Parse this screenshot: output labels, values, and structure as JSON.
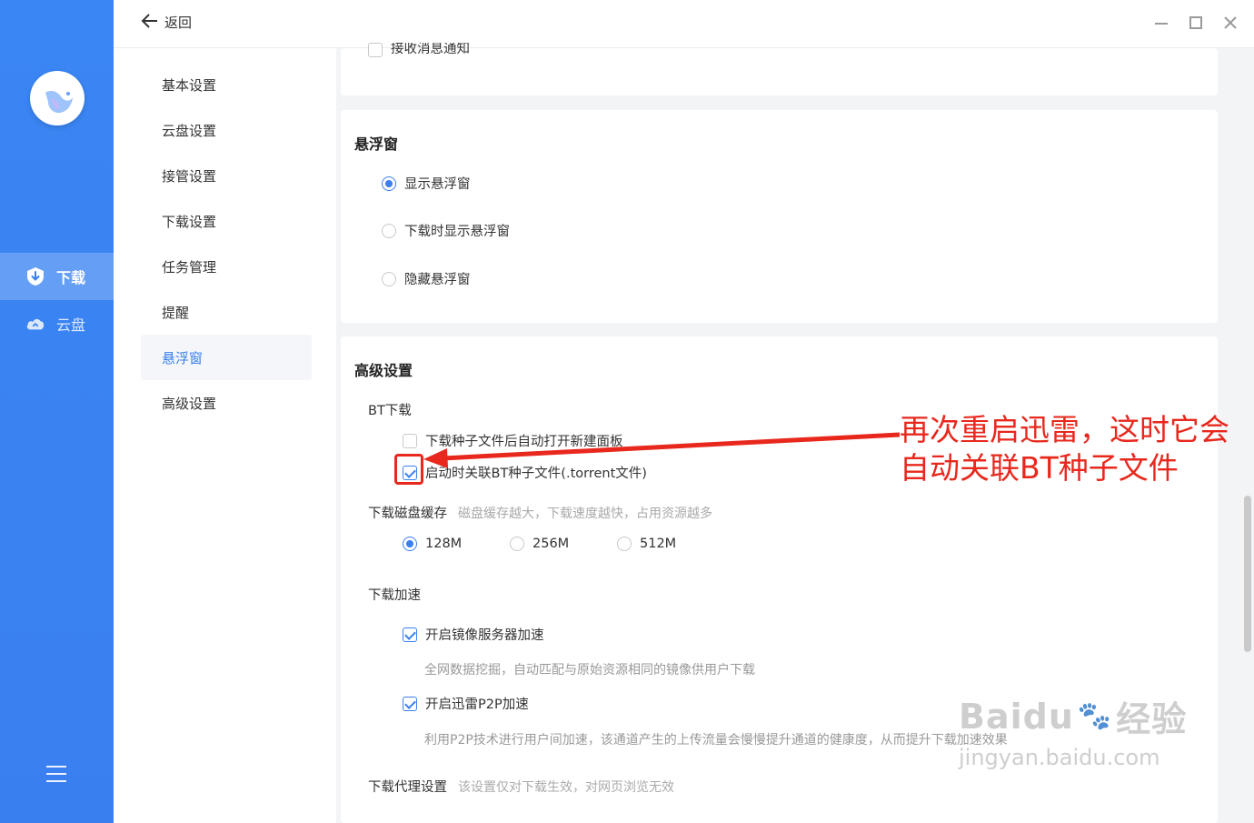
{
  "topbar": {
    "back_label": "返回"
  },
  "rail": {
    "items": [
      {
        "label": "下载",
        "icon": "download-shield-icon",
        "active": true
      },
      {
        "label": "云盘",
        "icon": "cloud-icon",
        "active": false
      }
    ]
  },
  "sidenav": {
    "items": [
      {
        "label": "基本设置"
      },
      {
        "label": "云盘设置"
      },
      {
        "label": "接管设置"
      },
      {
        "label": "下载设置"
      },
      {
        "label": "任务管理"
      },
      {
        "label": "提醒"
      },
      {
        "label": "悬浮窗",
        "active": true
      },
      {
        "label": "高级设置"
      }
    ]
  },
  "reminder_card": {
    "partial_option": "接收消息通知"
  },
  "float_window": {
    "title": "悬浮窗",
    "options": [
      {
        "label": "显示悬浮窗",
        "selected": true
      },
      {
        "label": "下载时显示悬浮窗",
        "selected": false
      },
      {
        "label": "隐藏悬浮窗",
        "selected": false
      }
    ]
  },
  "advanced": {
    "title": "高级设置",
    "bt": {
      "label": "BT下载",
      "opt1": {
        "label": "下载种子文件后自动打开新建面板",
        "checked": false
      },
      "opt2": {
        "label": "启动时关联BT种子文件(.torrent文件)",
        "checked": true
      }
    },
    "cache": {
      "label": "下载磁盘缓存",
      "hint": "磁盘缓存越大，下载速度越快，占用资源越多",
      "options": [
        {
          "label": "128M",
          "selected": true
        },
        {
          "label": "256M",
          "selected": false
        },
        {
          "label": "512M",
          "selected": false
        }
      ]
    },
    "accel": {
      "label": "下载加速",
      "mirror": {
        "label": "开启镜像服务器加速",
        "checked": true,
        "desc": "全网数据挖掘，自动匹配与原始资源相同的镜像供用户下载"
      },
      "p2p": {
        "label": "开启迅雷P2P加速",
        "checked": true,
        "desc": "利用P2P技术进行用户间加速，该通道产生的上传流量会慢慢提升通道的健康度，从而提升下载加速效果"
      }
    },
    "proxy": {
      "label": "下载代理设置",
      "hint": "该设置仅对下载生效，对网页浏览无效"
    }
  },
  "annotation": {
    "line1": "再次重启迅雷，这时它会",
    "line2": "自动关联BT种子文件"
  },
  "watermark": {
    "brand": "Baidu",
    "brand_cn": "经验",
    "url": "jingyan.baidu.com"
  },
  "colors": {
    "accent": "#3a7ff0",
    "annotation": "#e8281d",
    "rail": "#3a83f2"
  }
}
